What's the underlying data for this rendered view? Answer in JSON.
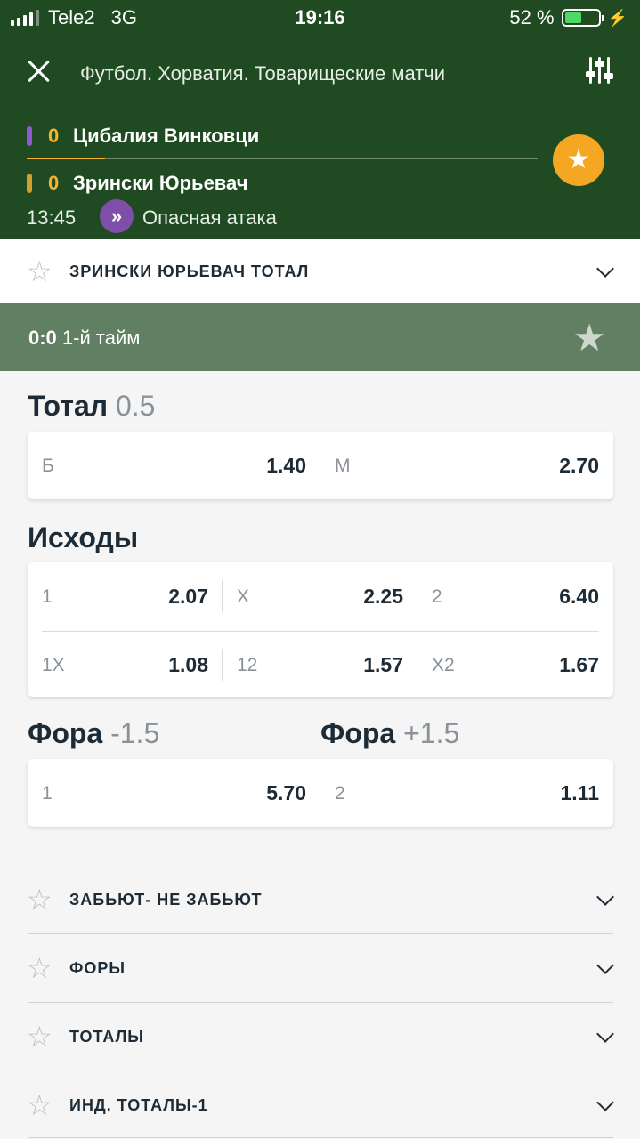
{
  "status": {
    "carrier": "Tele2",
    "network": "3G",
    "time": "19:16",
    "battery": "52 %",
    "battery_level": 0.52
  },
  "header": {
    "title": "Футбол. Хорватия. Товарищеские матчи",
    "team1": {
      "score": "0",
      "name": "Цибалия Винковци",
      "color": "#8e5bd0"
    },
    "team2": {
      "score": "0",
      "name": "Зрински Юрьевач",
      "color": "#d4a030"
    },
    "match_time": "13:45",
    "event_icon": "»",
    "event_text": "Опасная атака"
  },
  "top_section": {
    "label": "ЗРИНСКИ ЮРЬЕВАЧ ТОТАЛ"
  },
  "period": {
    "score": "0:0",
    "label": "1-й тайм"
  },
  "markets": {
    "total": {
      "title": "Тотал",
      "param": "0.5",
      "b_label": "Б",
      "b_value": "1.40",
      "m_label": "М",
      "m_value": "2.70"
    },
    "outcomes": {
      "title": "Исходы",
      "row1": [
        {
          "k": "1",
          "v": "2.07"
        },
        {
          "k": "X",
          "v": "2.25"
        },
        {
          "k": "2",
          "v": "6.40"
        }
      ],
      "row2": [
        {
          "k": "1X",
          "v": "1.08"
        },
        {
          "k": "12",
          "v": "1.57"
        },
        {
          "k": "X2",
          "v": "1.67"
        }
      ]
    },
    "handicap": {
      "title1": "Фора",
      "param1": "-1.5",
      "title2": "Фора",
      "param2": "+1.5",
      "c1": {
        "k": "1",
        "v": "5.70"
      },
      "c2": {
        "k": "2",
        "v": "1.11"
      }
    }
  },
  "sections": [
    {
      "label": "ЗАБЬЮТ- НЕ ЗАБЬЮТ"
    },
    {
      "label": "ФОРЫ"
    },
    {
      "label": "ТОТАЛЫ"
    },
    {
      "label": "ИНД. ТОТАЛЫ-1"
    }
  ],
  "colors": {
    "header_bg": "#1f4a22",
    "period_bg": "#617f62",
    "accent": "#f5a623"
  }
}
